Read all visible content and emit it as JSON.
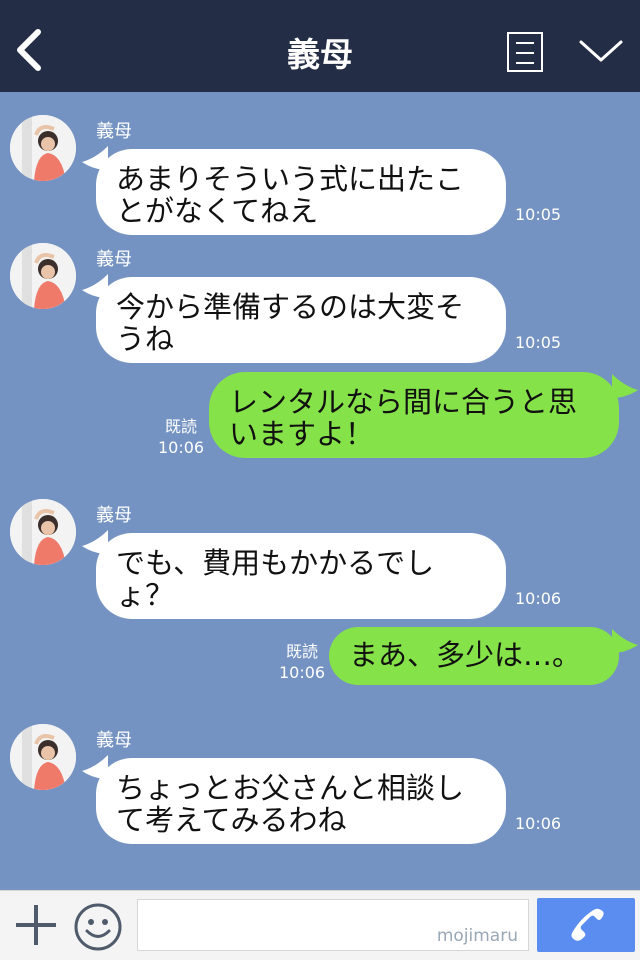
{
  "header": {
    "title": "義母"
  },
  "messages": [
    {
      "sender": "義母",
      "text": "あまりそういう式に出たことがなくてねえ",
      "time": "10:05",
      "direction": "in"
    },
    {
      "sender": "義母",
      "text": "今から準備するのは大変そうね",
      "time": "10:05",
      "direction": "in"
    },
    {
      "text": "レンタルなら間に合うと思いますよ！",
      "read": "既読",
      "time": "10:06",
      "direction": "out"
    },
    {
      "sender": "義母",
      "text": "でも、費用もかかるでしょ？",
      "time": "10:06",
      "direction": "in"
    },
    {
      "text": "まあ、多少は…。",
      "read": "既読",
      "time": "10:06",
      "direction": "out"
    },
    {
      "sender": "義母",
      "text": "ちょっとお父さんと相談して考えてみるわね",
      "time": "10:06",
      "direction": "in"
    }
  ],
  "input": {
    "watermark": "mojimaru",
    "value": ""
  },
  "colors": {
    "header_bg": "#232d45",
    "chat_bg": "#7493c2",
    "incoming_bubble": "#ffffff",
    "outgoing_bubble": "#85e249",
    "call_button": "#5b8df0"
  },
  "icons": [
    "back-chevron-icon",
    "note-icon",
    "chevron-down-icon",
    "plus-icon",
    "emoji-icon",
    "phone-icon"
  ]
}
